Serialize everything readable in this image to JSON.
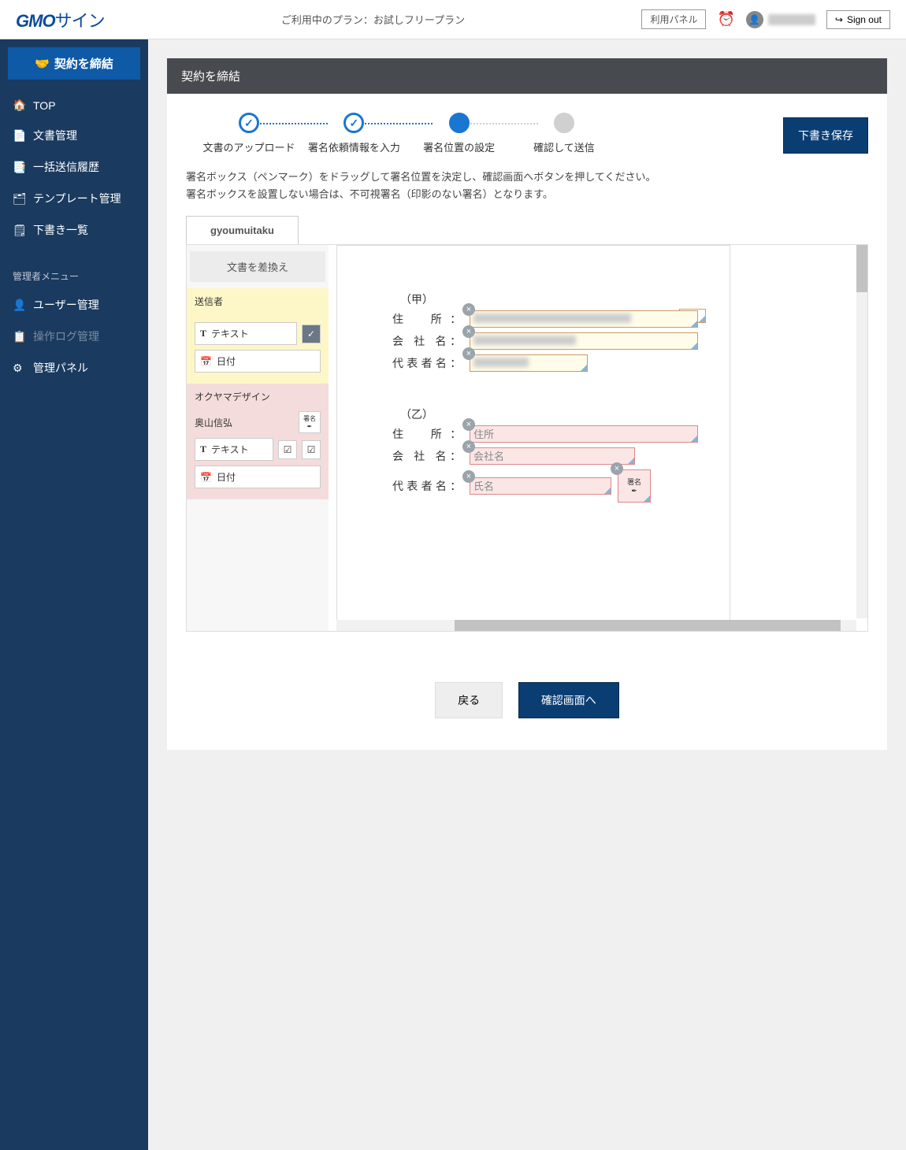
{
  "header": {
    "logo_main": "GMO",
    "logo_sign": "サイン",
    "plan_line": "ご利用中のプラン：お試しフリープラン",
    "panel_btn": "利用パネル",
    "signout": "Sign out"
  },
  "sidebar": {
    "conclude": "契約を締結",
    "items": [
      "TOP",
      "文書管理",
      "一括送信履歴",
      "テンプレート管理",
      "下書き一覧"
    ],
    "admin_section": "管理者メニュー",
    "admin_items": [
      "ユーザー管理",
      "操作ログ管理",
      "管理パネル"
    ]
  },
  "page": {
    "title": "契約を締結",
    "steps": [
      "文書のアップロード",
      "署名依頼情報を入力",
      "署名位置の設定",
      "確認して送信"
    ],
    "save_draft": "下書き保存",
    "instr1": "署名ボックス（ペンマーク）をドラッグして署名位置を決定し、確認画面へボタンを押してください。",
    "instr2": "署名ボックスを設置しない場合は、不可視署名（印影のない署名）となります。",
    "tab": "gyoumuitaku"
  },
  "tools": {
    "replace": "文書を差換え",
    "sender_label": "送信者",
    "text_tool": "テキスト",
    "date_tool": "日付",
    "party_org": "オクヤマデザイン",
    "party_name": "奥山信弘",
    "sign_label": "署名"
  },
  "doc": {
    "kou_hdr": "（甲）",
    "otsu_hdr": "（乙）",
    "addr_label": "住　所：",
    "company_label": "会 社 名：",
    "rep_label": "代表者名：",
    "ph_addr": "住所",
    "ph_company": "会社名",
    "ph_name": "氏名"
  },
  "actions": {
    "back": "戻る",
    "confirm": "確認画面へ"
  }
}
